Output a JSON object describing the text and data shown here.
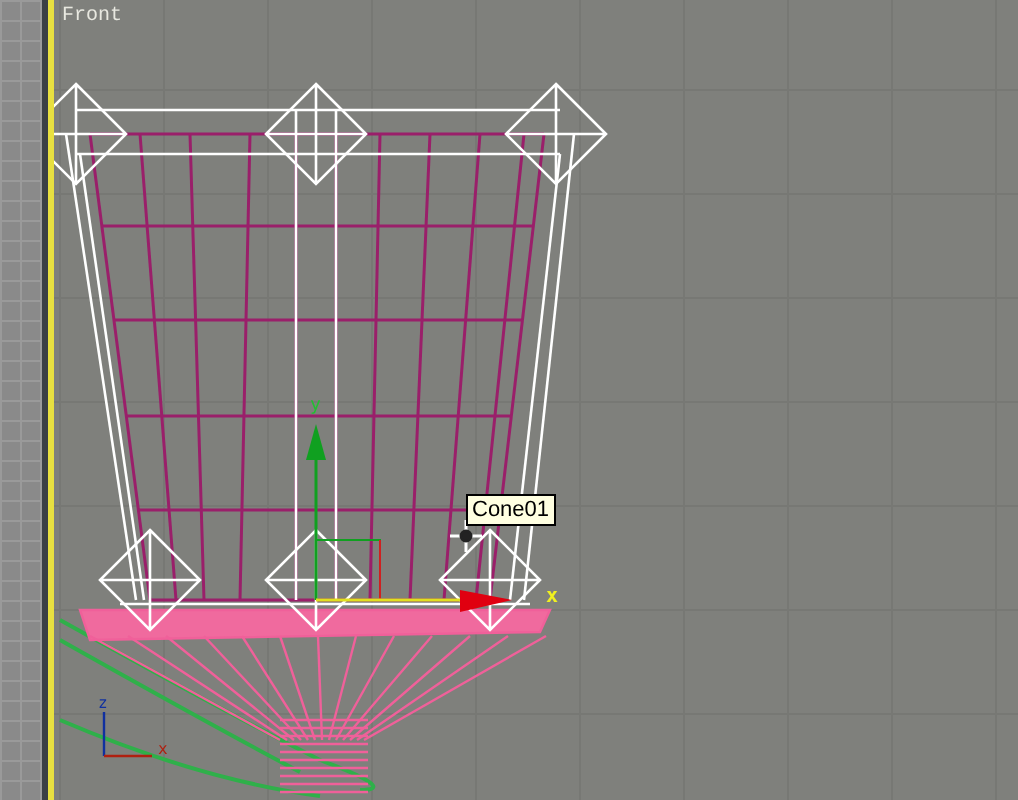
{
  "viewport": {
    "label": "Front",
    "active": true
  },
  "tooltip": {
    "text": "Cone01"
  },
  "gizmo": {
    "y_label": "y",
    "x_label": "x"
  },
  "axis_tripod": {
    "z_label": "z",
    "x_label": "x"
  }
}
